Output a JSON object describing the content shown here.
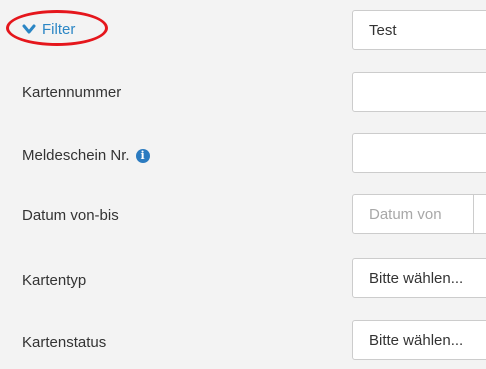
{
  "filter": {
    "toggle_label": "Filter"
  },
  "fields": {
    "name": {
      "value": "Test"
    },
    "kartennummer": {
      "label": "Kartennummer",
      "value": ""
    },
    "meldeschein": {
      "label": "Meldeschein Nr.",
      "value": "",
      "info_icon": "info-icon"
    },
    "datum": {
      "label": "Datum von-bis",
      "from_placeholder": "Datum von"
    },
    "kartentyp": {
      "label": "Kartentyp",
      "selected": "Bitte wählen..."
    },
    "kartenstatus": {
      "label": "Kartenstatus",
      "selected": "Bitte wählen..."
    }
  },
  "colors": {
    "accent": "#2b86c5",
    "highlight": "#e5161c",
    "panel_bg": "#f3f3f3"
  }
}
